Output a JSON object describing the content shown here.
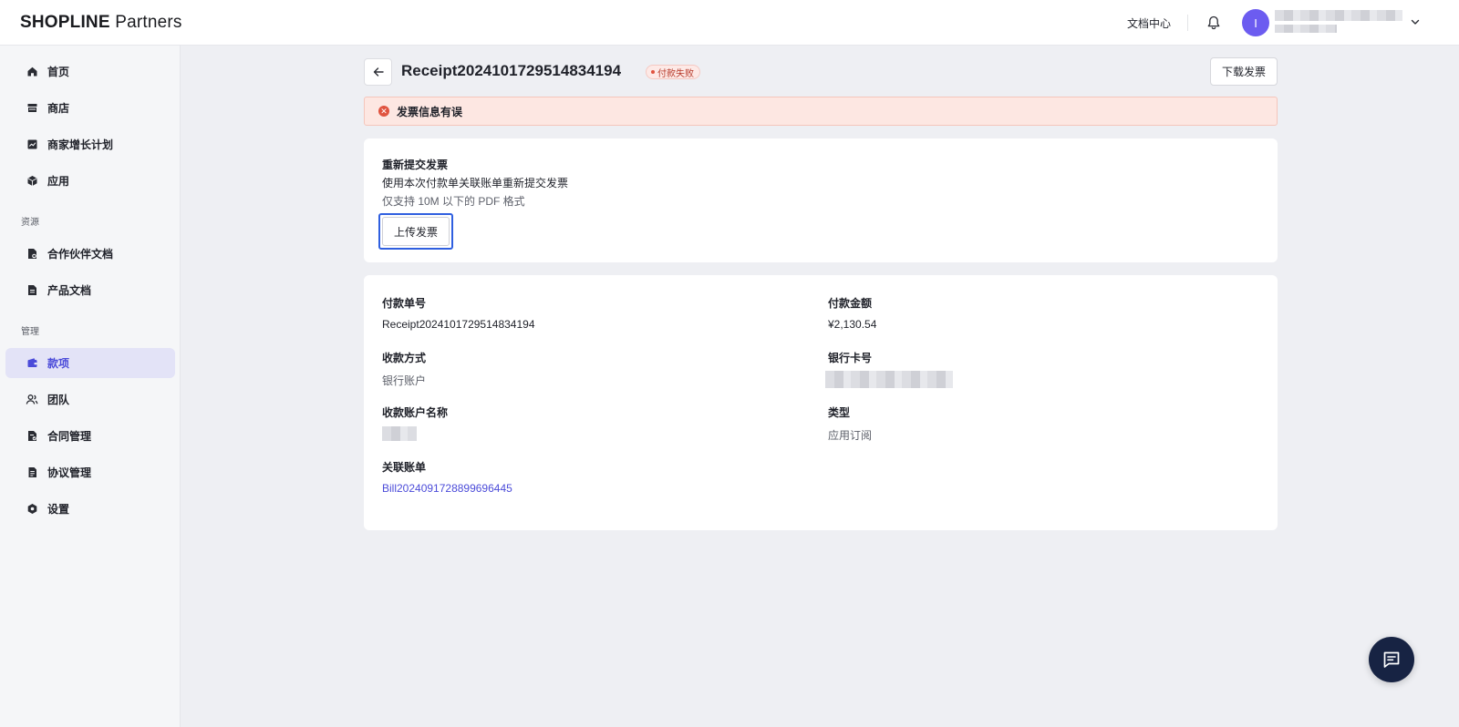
{
  "header": {
    "logo_bold": "SHOPLINE",
    "logo_light": "Partners",
    "docs_link": "文档中心",
    "avatar_initial": "I"
  },
  "sidebar": {
    "items_main": [
      {
        "label": "首页",
        "icon": "home-icon"
      },
      {
        "label": "商店",
        "icon": "store-icon"
      },
      {
        "label": "商家增长计划",
        "icon": "growth-chart-icon"
      },
      {
        "label": "应用",
        "icon": "app-box-icon"
      }
    ],
    "section_resources": "资源",
    "items_resources": [
      {
        "label": "合作伙伴文档",
        "icon": "partner-doc-icon"
      },
      {
        "label": "产品文档",
        "icon": "product-doc-icon"
      }
    ],
    "section_manage": "管理",
    "items_manage": [
      {
        "label": "款项",
        "icon": "wallet-icon",
        "active": true
      },
      {
        "label": "团队",
        "icon": "team-icon"
      },
      {
        "label": "合同管理",
        "icon": "contract-icon"
      },
      {
        "label": "协议管理",
        "icon": "agreement-icon"
      },
      {
        "label": "设置",
        "icon": "settings-icon"
      }
    ]
  },
  "page": {
    "title": "Receipt2024101729514834194",
    "status": "付款失败",
    "download_button": "下载发票"
  },
  "alert": {
    "message": "发票信息有误"
  },
  "resubmit": {
    "title": "重新提交发票",
    "description": "使用本次付款单关联账单重新提交发票",
    "hint": "仅支持 10M 以下的 PDF 格式",
    "upload_button": "上传发票"
  },
  "details": {
    "payment_no_label": "付款单号",
    "payment_no": "Receipt2024101729514834194",
    "amount_label": "付款金额",
    "amount": "¥2,130.54",
    "method_label": "收款方式",
    "method": "银行账户",
    "card_label": "银行卡号",
    "account_name_label": "收款账户名称",
    "type_label": "类型",
    "type": "应用订阅",
    "bill_label": "关联账单",
    "bill": "Bill2024091728899696445"
  },
  "colors": {
    "accent": "#4b4bd9",
    "error": "#e0533f",
    "fab": "#172343"
  }
}
